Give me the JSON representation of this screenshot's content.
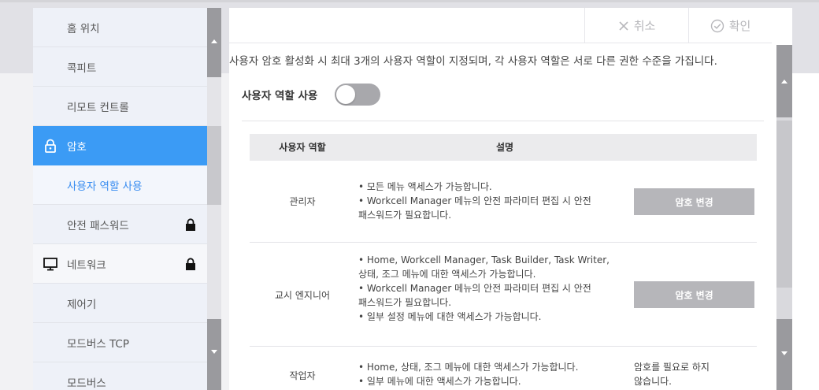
{
  "sidebar": {
    "items": [
      {
        "label": "홈 위치"
      },
      {
        "label": "콕피트"
      },
      {
        "label": "리모트 컨트롤"
      },
      {
        "label": "암호",
        "icon": "lock-icon"
      },
      {
        "label": "사용자 역할 사용"
      },
      {
        "label": "안전 패스워드",
        "icon": "lock-icon"
      },
      {
        "label": "네트워크",
        "icon": "monitor-icon"
      },
      {
        "label": "제어기"
      },
      {
        "label": "모드버스 TCP"
      },
      {
        "label": "모드버스"
      }
    ]
  },
  "toolbar": {
    "cancel_label": "취소",
    "confirm_label": "확인"
  },
  "main": {
    "description": "사용자 암호 활성화 시 최대 3개의 사용자 역할이 지정되며, 각 사용자 역할은 서로 다른 권한 수준을 가집니다.",
    "toggle_label": "사용자 역할 사용",
    "toggle_on": false,
    "table": {
      "headers": [
        "사용자 역할",
        "설명"
      ],
      "rows": [
        {
          "role": "관리자",
          "bullets": [
            "• 모든 메뉴 액세스가 가능합니다.",
            "• Workcell Manager 메뉴의 안전 파라미터 편집 시 안전",
            "패스워드가 필요합니다."
          ],
          "action": "암호 변경"
        },
        {
          "role": "교시 엔지니어",
          "bullets": [
            "• Home, Workcell Manager, Task Builder, Task Writer,",
            "상태, 조그 메뉴에 대한 액세스가 가능합니다.",
            "• Workcell Manager 메뉴의 안전 파라미터 편집 시 안전",
            "패스워드가 필요합니다.",
            "• 일부 설정 메뉴에 대한 액세스가 가능합니다."
          ],
          "action": "암호 변경"
        },
        {
          "role": "작업자",
          "bullets": [
            "• Home, 상태, 조그 메뉴에 대한 액세스가 가능합니다.",
            "• 일부 메뉴에 대한 액세스가 가능합니다."
          ],
          "note": [
            "암호를 필요로 하지",
            "않습니다."
          ]
        }
      ]
    }
  },
  "colors": {
    "accent": "#3b9bf5",
    "active_sub_text": "#3a8df0",
    "button_disabled": "#b6b6ba"
  }
}
